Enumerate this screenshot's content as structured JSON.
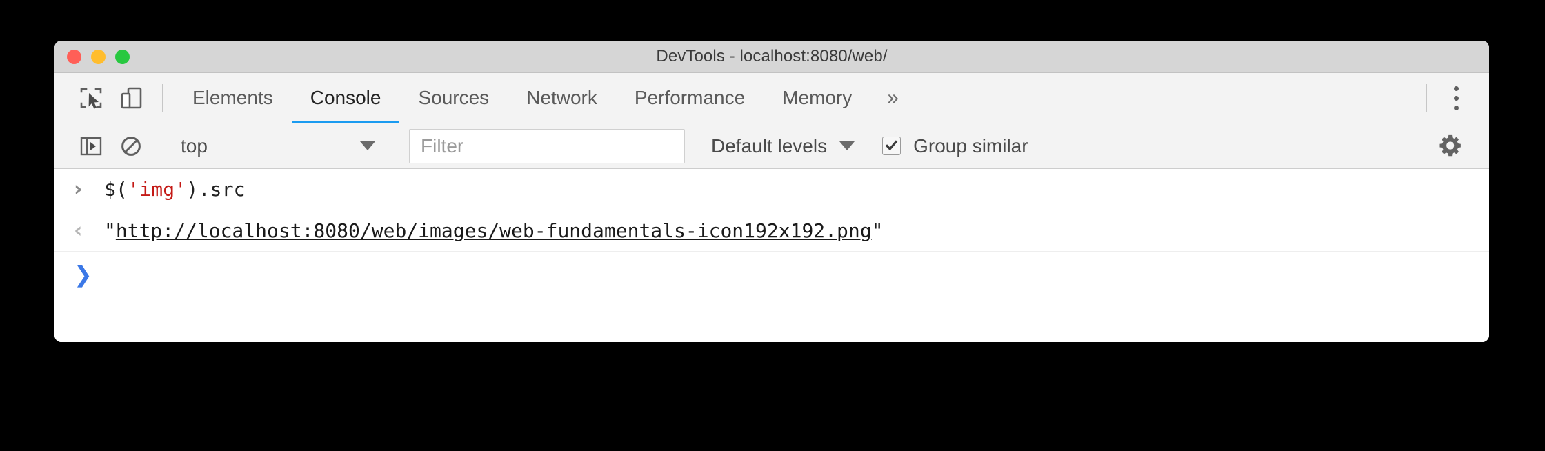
{
  "window": {
    "title": "DevTools - localhost:8080/web/",
    "traffic_lights": [
      {
        "name": "close",
        "color": "#ff5f57"
      },
      {
        "name": "minimize",
        "color": "#ffbd2e"
      },
      {
        "name": "maximize",
        "color": "#28c840"
      }
    ]
  },
  "tabbar": {
    "inspect_icon": "inspect-element-icon",
    "device_icon": "device-toolbar-icon",
    "tabs": [
      {
        "label": "Elements",
        "active": false
      },
      {
        "label": "Console",
        "active": true
      },
      {
        "label": "Sources",
        "active": false
      },
      {
        "label": "Network",
        "active": false
      },
      {
        "label": "Performance",
        "active": false
      },
      {
        "label": "Memory",
        "active": false
      }
    ],
    "overflow_label": "»",
    "menu_icon": "more-vertical-icon",
    "active_underline_color": "#1a9bf0"
  },
  "toolbar": {
    "sidebar_icon": "console-sidebar-icon",
    "clear_icon": "clear-console-icon",
    "context": {
      "value": "top",
      "caret_icon": "chevron-down-icon"
    },
    "filter": {
      "value": "",
      "placeholder": "Filter"
    },
    "levels": {
      "label": "Default levels",
      "caret_icon": "chevron-down-icon"
    },
    "group_similar": {
      "label": "Group similar",
      "checked": true
    },
    "settings_icon": "gear-icon"
  },
  "console": {
    "rows": [
      {
        "type": "input",
        "prompt": "›",
        "code_prefix": "$(",
        "code_string": "'img'",
        "code_suffix": ").src"
      },
      {
        "type": "result",
        "prompt": "‹",
        "quote_open": "\"",
        "link": "http://localhost:8080/web/images/web-fundamentals-icon192x192.png",
        "quote_close": "\""
      }
    ],
    "active_prompt": "❯"
  }
}
